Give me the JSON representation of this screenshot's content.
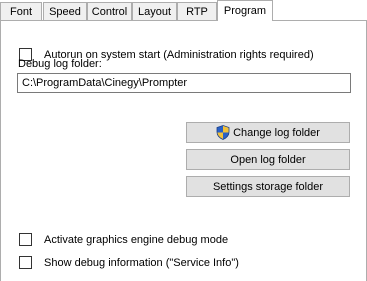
{
  "tabs": [
    {
      "label": "Font"
    },
    {
      "label": "Speed"
    },
    {
      "label": "Control"
    },
    {
      "label": "Layout"
    },
    {
      "label": "RTP"
    },
    {
      "label": "Program"
    }
  ],
  "active_tab": "Program",
  "autorun": {
    "label": "Autorun on system start  (Administration rights required)",
    "checked": false
  },
  "debug_log": {
    "label": "Debug log folder:",
    "value": "C:\\ProgramData\\Cinegy\\Prompter"
  },
  "buttons": {
    "change_log_folder": "Change log folder",
    "open_log_folder": "Open log folder",
    "settings_storage_folder": "Settings storage folder"
  },
  "graphics_debug": {
    "label": "Activate graphics engine debug mode",
    "checked": false
  },
  "service_info": {
    "label": "Show debug information (\"Service Info\")",
    "checked": false
  },
  "icons": {
    "change_log_folder_icon": "uac-shield-icon"
  }
}
